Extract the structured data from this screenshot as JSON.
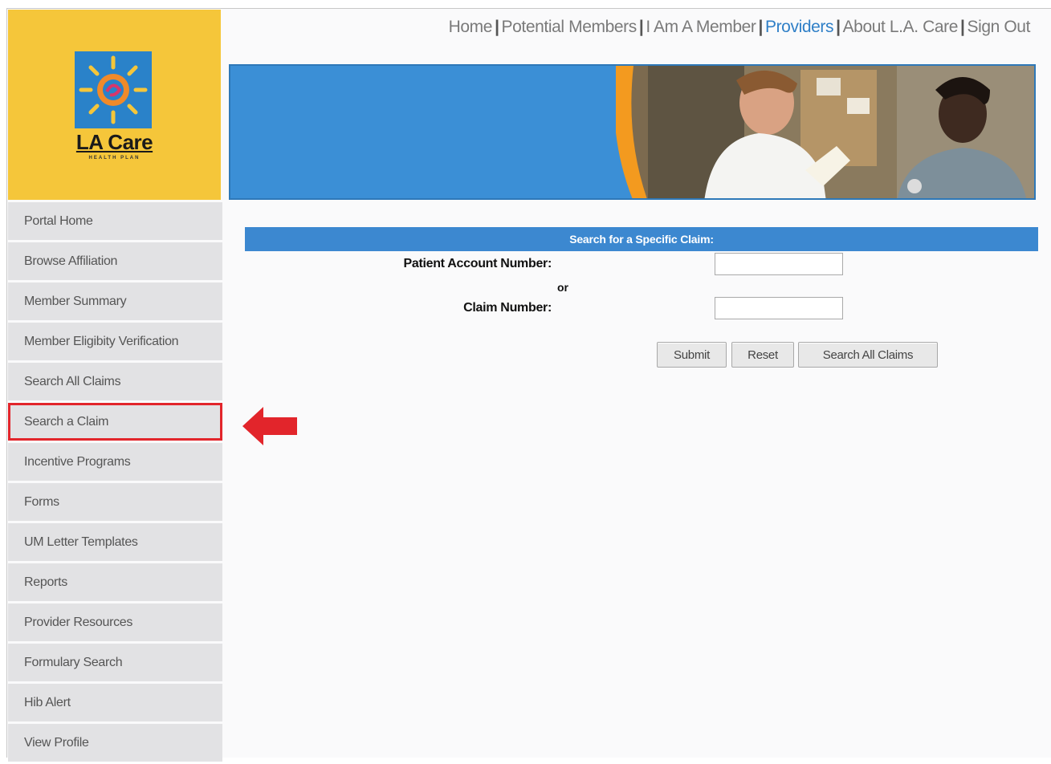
{
  "brand": {
    "name": "LA Care",
    "tagline": "HEALTH PLAN",
    "logo_bg": "#f5c63a"
  },
  "topnav": {
    "items": [
      {
        "label": "Home"
      },
      {
        "label": "Potential Members"
      },
      {
        "label": "I Am A Member"
      },
      {
        "label": "Providers",
        "current": true
      },
      {
        "label": "About L.A. Care"
      },
      {
        "label": "Sign Out"
      }
    ],
    "separator": "|",
    "accent": "#2f7fc7"
  },
  "sidebar": {
    "items": [
      {
        "label": "Portal Home"
      },
      {
        "label": "Browse Affiliation"
      },
      {
        "label": "Member Summary"
      },
      {
        "label": "Member Eligibity Verification"
      },
      {
        "label": "Search All Claims"
      },
      {
        "label": "Search a Claim",
        "active": true
      },
      {
        "label": "Incentive Programs"
      },
      {
        "label": "Forms"
      },
      {
        "label": "UM Letter Templates"
      },
      {
        "label": "Reports"
      },
      {
        "label": "Provider Resources"
      },
      {
        "label": "Formulary Search"
      },
      {
        "label": "Hib Alert"
      },
      {
        "label": "View Profile"
      }
    ],
    "highlight_color": "#e2252b"
  },
  "search": {
    "header": "Search for a Specific Claim:",
    "patient_account_label": "Patient Account Number:",
    "patient_account_value": "",
    "or_label": "or",
    "claim_number_label": "Claim Number:",
    "claim_number_value": "",
    "buttons": {
      "submit": "Submit",
      "reset": "Reset",
      "search_all": "Search All Claims"
    }
  },
  "annotation": {
    "arrow_icon": "left-arrow-icon",
    "color": "#e2252b"
  }
}
